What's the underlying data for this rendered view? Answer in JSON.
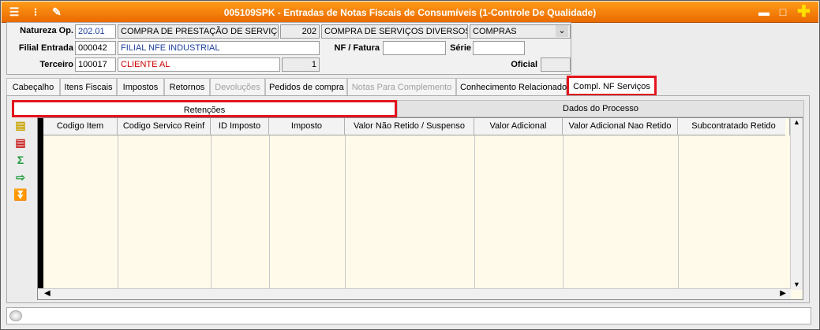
{
  "window": {
    "title": "005109SPK - Entradas de Notas Fiscais de Consumíveis (1-Controle De Qualidade)"
  },
  "header": {
    "natureza": {
      "label": "Natureza Op.",
      "code": "202.01",
      "desc": "COMPRA DE PRESTAÇÃO DE SERVIÇOS",
      "num": "202",
      "desc2": "COMPRA DE SERVIÇOS DIVERSOS",
      "type": "COMPRAS"
    },
    "filial": {
      "label": "Filial Entrada",
      "code": "000042",
      "desc": "FILIAL NFE INDUSTRIAL"
    },
    "terceiro": {
      "label": "Terceiro",
      "code": "100017",
      "desc": "CLIENTE AL",
      "num": "1"
    },
    "nf_label": "NF / Fatura",
    "serie_label": "Série",
    "oficial_label": "Oficial"
  },
  "tabs": [
    "Cabeçalho",
    "Itens Fiscais",
    "Impostos",
    "Retornos",
    "Devoluções",
    "Pedidos de compra",
    "Notas Para Complemento",
    "Conhecimento Relacionado",
    "Compl. NF Serviços"
  ],
  "subtabs": [
    "Retenções",
    "Dados do Processo"
  ],
  "grid": {
    "columns": [
      "Codigo Item",
      "Codigo Servico Reinf",
      "ID Imposto",
      "Imposto",
      "Valor Não Retido / Suspenso",
      "Valor Adicional",
      "Valor Adicional Nao Retido",
      "Subcontratado Retido"
    ]
  },
  "colors": {
    "title": "#f07a00",
    "highlight": "#e4151c",
    "grid_bg": "#fffaea"
  }
}
